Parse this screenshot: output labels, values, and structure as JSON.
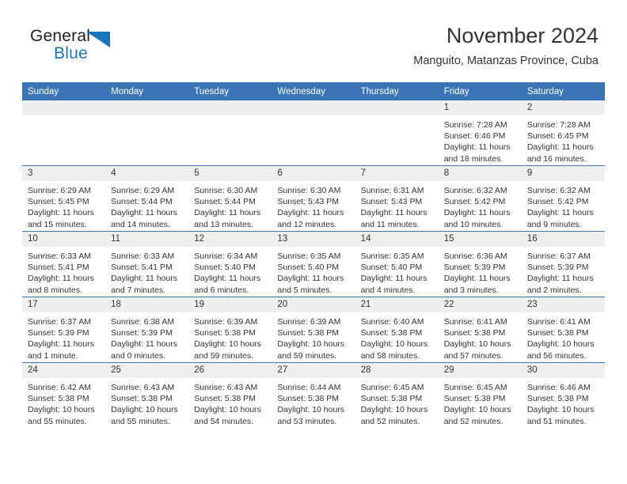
{
  "logo": {
    "word_one": "General",
    "word_two": "Blue",
    "triangle_color": "#1b75bb",
    "icon": "triangle-icon"
  },
  "header": {
    "title": "November 2024",
    "subtitle": "Manguito, Matanzas Province, Cuba"
  },
  "theme": {
    "header_blue": "#3b74b5",
    "daynum_band": "#efefef",
    "text": "#333333"
  },
  "calendar": {
    "weekday_headers": [
      "Sunday",
      "Monday",
      "Tuesday",
      "Wednesday",
      "Thursday",
      "Friday",
      "Saturday"
    ],
    "labels": {
      "sunrise": "Sunrise:",
      "sunset": "Sunset:",
      "daylight": "Daylight:"
    },
    "weeks": [
      [
        {
          "day": "",
          "empty": true
        },
        {
          "day": "",
          "empty": true
        },
        {
          "day": "",
          "empty": true
        },
        {
          "day": "",
          "empty": true
        },
        {
          "day": "",
          "empty": true
        },
        {
          "day": "1",
          "sunrise": "Sunrise: 7:28 AM",
          "sunset": "Sunset: 6:46 PM",
          "daylight_1": "Daylight: 11 hours",
          "daylight_2": "and 18 minutes."
        },
        {
          "day": "2",
          "sunrise": "Sunrise: 7:28 AM",
          "sunset": "Sunset: 6:45 PM",
          "daylight_1": "Daylight: 11 hours",
          "daylight_2": "and 16 minutes."
        }
      ],
      [
        {
          "day": "3",
          "sunrise": "Sunrise: 6:29 AM",
          "sunset": "Sunset: 5:45 PM",
          "daylight_1": "Daylight: 11 hours",
          "daylight_2": "and 15 minutes."
        },
        {
          "day": "4",
          "sunrise": "Sunrise: 6:29 AM",
          "sunset": "Sunset: 5:44 PM",
          "daylight_1": "Daylight: 11 hours",
          "daylight_2": "and 14 minutes."
        },
        {
          "day": "5",
          "sunrise": "Sunrise: 6:30 AM",
          "sunset": "Sunset: 5:44 PM",
          "daylight_1": "Daylight: 11 hours",
          "daylight_2": "and 13 minutes."
        },
        {
          "day": "6",
          "sunrise": "Sunrise: 6:30 AM",
          "sunset": "Sunset: 5:43 PM",
          "daylight_1": "Daylight: 11 hours",
          "daylight_2": "and 12 minutes."
        },
        {
          "day": "7",
          "sunrise": "Sunrise: 6:31 AM",
          "sunset": "Sunset: 5:43 PM",
          "daylight_1": "Daylight: 11 hours",
          "daylight_2": "and 11 minutes."
        },
        {
          "day": "8",
          "sunrise": "Sunrise: 6:32 AM",
          "sunset": "Sunset: 5:42 PM",
          "daylight_1": "Daylight: 11 hours",
          "daylight_2": "and 10 minutes."
        },
        {
          "day": "9",
          "sunrise": "Sunrise: 6:32 AM",
          "sunset": "Sunset: 5:42 PM",
          "daylight_1": "Daylight: 11 hours",
          "daylight_2": "and 9 minutes."
        }
      ],
      [
        {
          "day": "10",
          "sunrise": "Sunrise: 6:33 AM",
          "sunset": "Sunset: 5:41 PM",
          "daylight_1": "Daylight: 11 hours",
          "daylight_2": "and 8 minutes."
        },
        {
          "day": "11",
          "sunrise": "Sunrise: 6:33 AM",
          "sunset": "Sunset: 5:41 PM",
          "daylight_1": "Daylight: 11 hours",
          "daylight_2": "and 7 minutes."
        },
        {
          "day": "12",
          "sunrise": "Sunrise: 6:34 AM",
          "sunset": "Sunset: 5:40 PM",
          "daylight_1": "Daylight: 11 hours",
          "daylight_2": "and 6 minutes."
        },
        {
          "day": "13",
          "sunrise": "Sunrise: 6:35 AM",
          "sunset": "Sunset: 5:40 PM",
          "daylight_1": "Daylight: 11 hours",
          "daylight_2": "and 5 minutes."
        },
        {
          "day": "14",
          "sunrise": "Sunrise: 6:35 AM",
          "sunset": "Sunset: 5:40 PM",
          "daylight_1": "Daylight: 11 hours",
          "daylight_2": "and 4 minutes."
        },
        {
          "day": "15",
          "sunrise": "Sunrise: 6:36 AM",
          "sunset": "Sunset: 5:39 PM",
          "daylight_1": "Daylight: 11 hours",
          "daylight_2": "and 3 minutes."
        },
        {
          "day": "16",
          "sunrise": "Sunrise: 6:37 AM",
          "sunset": "Sunset: 5:39 PM",
          "daylight_1": "Daylight: 11 hours",
          "daylight_2": "and 2 minutes."
        }
      ],
      [
        {
          "day": "17",
          "sunrise": "Sunrise: 6:37 AM",
          "sunset": "Sunset: 5:39 PM",
          "daylight_1": "Daylight: 11 hours",
          "daylight_2": "and 1 minute."
        },
        {
          "day": "18",
          "sunrise": "Sunrise: 6:38 AM",
          "sunset": "Sunset: 5:39 PM",
          "daylight_1": "Daylight: 11 hours",
          "daylight_2": "and 0 minutes."
        },
        {
          "day": "19",
          "sunrise": "Sunrise: 6:39 AM",
          "sunset": "Sunset: 5:38 PM",
          "daylight_1": "Daylight: 10 hours",
          "daylight_2": "and 59 minutes."
        },
        {
          "day": "20",
          "sunrise": "Sunrise: 6:39 AM",
          "sunset": "Sunset: 5:38 PM",
          "daylight_1": "Daylight: 10 hours",
          "daylight_2": "and 59 minutes."
        },
        {
          "day": "21",
          "sunrise": "Sunrise: 6:40 AM",
          "sunset": "Sunset: 5:38 PM",
          "daylight_1": "Daylight: 10 hours",
          "daylight_2": "and 58 minutes."
        },
        {
          "day": "22",
          "sunrise": "Sunrise: 6:41 AM",
          "sunset": "Sunset: 5:38 PM",
          "daylight_1": "Daylight: 10 hours",
          "daylight_2": "and 57 minutes."
        },
        {
          "day": "23",
          "sunrise": "Sunrise: 6:41 AM",
          "sunset": "Sunset: 5:38 PM",
          "daylight_1": "Daylight: 10 hours",
          "daylight_2": "and 56 minutes."
        }
      ],
      [
        {
          "day": "24",
          "sunrise": "Sunrise: 6:42 AM",
          "sunset": "Sunset: 5:38 PM",
          "daylight_1": "Daylight: 10 hours",
          "daylight_2": "and 55 minutes."
        },
        {
          "day": "25",
          "sunrise": "Sunrise: 6:43 AM",
          "sunset": "Sunset: 5:38 PM",
          "daylight_1": "Daylight: 10 hours",
          "daylight_2": "and 55 minutes."
        },
        {
          "day": "26",
          "sunrise": "Sunrise: 6:43 AM",
          "sunset": "Sunset: 5:38 PM",
          "daylight_1": "Daylight: 10 hours",
          "daylight_2": "and 54 minutes."
        },
        {
          "day": "27",
          "sunrise": "Sunrise: 6:44 AM",
          "sunset": "Sunset: 5:38 PM",
          "daylight_1": "Daylight: 10 hours",
          "daylight_2": "and 53 minutes."
        },
        {
          "day": "28",
          "sunrise": "Sunrise: 6:45 AM",
          "sunset": "Sunset: 5:38 PM",
          "daylight_1": "Daylight: 10 hours",
          "daylight_2": "and 52 minutes."
        },
        {
          "day": "29",
          "sunrise": "Sunrise: 6:45 AM",
          "sunset": "Sunset: 5:38 PM",
          "daylight_1": "Daylight: 10 hours",
          "daylight_2": "and 52 minutes."
        },
        {
          "day": "30",
          "sunrise": "Sunrise: 6:46 AM",
          "sunset": "Sunset: 5:38 PM",
          "daylight_1": "Daylight: 10 hours",
          "daylight_2": "and 51 minutes."
        }
      ]
    ]
  }
}
